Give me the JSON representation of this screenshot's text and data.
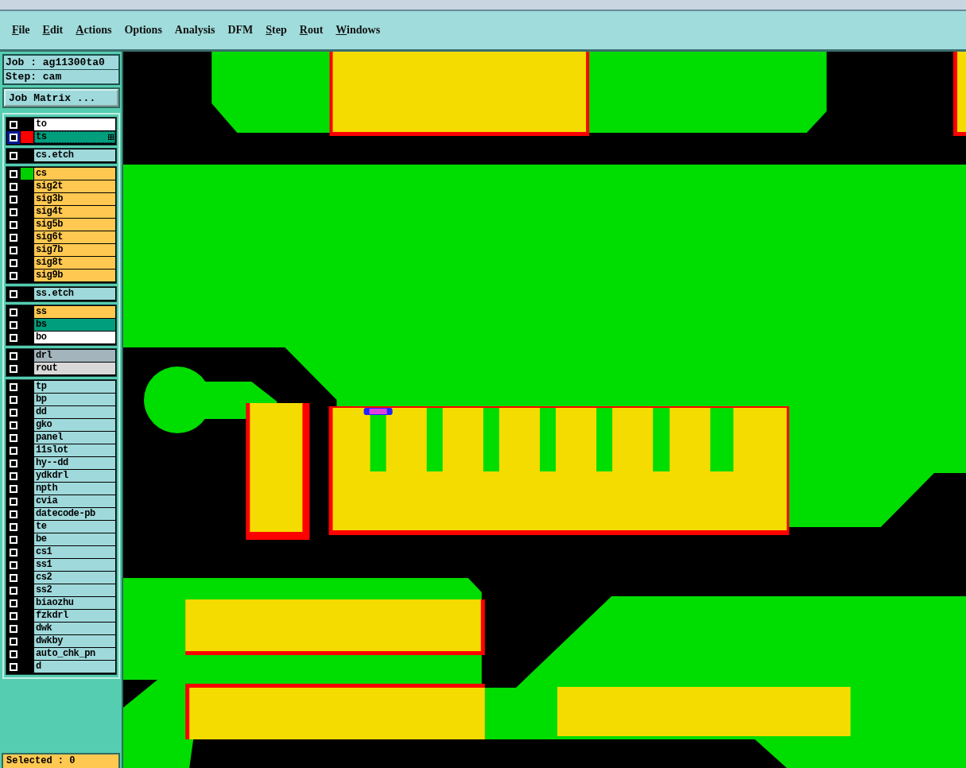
{
  "menu": [
    {
      "label": "File",
      "underlined": true
    },
    {
      "label": "Edit",
      "underlined": true
    },
    {
      "label": "Actions",
      "underlined": true
    },
    {
      "label": "Options",
      "underlined": false
    },
    {
      "label": "Analysis",
      "underlined": false
    },
    {
      "label": "DFM",
      "underlined": false
    },
    {
      "label": "Step",
      "underlined": true
    },
    {
      "label": "Rout",
      "underlined": true
    },
    {
      "label": "Windows",
      "underlined": true
    }
  ],
  "job": {
    "job_label": "Job : ag11300ta0",
    "step_label": "Step: cam",
    "matrix_button": "Job Matrix ..."
  },
  "layer_groups": [
    [
      {
        "name": "to",
        "kind": "silk",
        "checked": true,
        "selected": false
      },
      {
        "name": "ts",
        "kind": "mask",
        "checked": true,
        "selected": true,
        "color": "#ff0000"
      }
    ],
    [
      {
        "name": "cs.etch",
        "kind": "misc",
        "checked": true,
        "selected": false
      }
    ],
    [
      {
        "name": "cs",
        "kind": "signal",
        "checked": true,
        "selected": false,
        "color": "#00d000"
      },
      {
        "name": "sig2t",
        "kind": "signal",
        "checked": true,
        "selected": false
      },
      {
        "name": "sig3b",
        "kind": "signal",
        "checked": true,
        "selected": false
      },
      {
        "name": "sig4t",
        "kind": "signal",
        "checked": true,
        "selected": false
      },
      {
        "name": "sig5b",
        "kind": "signal",
        "checked": true,
        "selected": false
      },
      {
        "name": "sig6t",
        "kind": "signal",
        "checked": true,
        "selected": false
      },
      {
        "name": "sig7b",
        "kind": "signal",
        "checked": true,
        "selected": false
      },
      {
        "name": "sig8t",
        "kind": "signal",
        "checked": true,
        "selected": false
      },
      {
        "name": "sig9b",
        "kind": "signal",
        "checked": true,
        "selected": false
      }
    ],
    [
      {
        "name": "ss.etch",
        "kind": "misc",
        "checked": true,
        "selected": false
      }
    ],
    [
      {
        "name": "ss",
        "kind": "signal",
        "checked": true,
        "selected": false
      },
      {
        "name": "bs",
        "kind": "mask",
        "checked": true,
        "selected": false
      },
      {
        "name": "bo",
        "kind": "silk",
        "checked": true,
        "selected": false
      }
    ],
    [
      {
        "name": "drl",
        "kind": "drill",
        "checked": true,
        "selected": false
      },
      {
        "name": "rout",
        "kind": "rout",
        "checked": true,
        "selected": false
      }
    ],
    [
      {
        "name": "tp",
        "kind": "misc",
        "checked": true,
        "selected": false
      },
      {
        "name": "bp",
        "kind": "misc",
        "checked": true,
        "selected": false
      },
      {
        "name": "dd",
        "kind": "misc",
        "checked": true,
        "selected": false
      },
      {
        "name": "gko",
        "kind": "misc",
        "checked": true,
        "selected": false
      },
      {
        "name": "panel",
        "kind": "misc",
        "checked": true,
        "selected": false
      },
      {
        "name": "11slot",
        "kind": "misc",
        "checked": true,
        "selected": false
      },
      {
        "name": "hy--dd",
        "kind": "misc",
        "checked": true,
        "selected": false
      },
      {
        "name": "ydkdrl",
        "kind": "misc",
        "checked": true,
        "selected": false
      },
      {
        "name": "npth",
        "kind": "misc",
        "checked": true,
        "selected": false
      },
      {
        "name": "cvia",
        "kind": "misc",
        "checked": true,
        "selected": false
      },
      {
        "name": "datecode-pb",
        "kind": "misc",
        "checked": true,
        "selected": false
      },
      {
        "name": "te",
        "kind": "misc",
        "checked": true,
        "selected": false
      },
      {
        "name": "be",
        "kind": "misc",
        "checked": true,
        "selected": false
      },
      {
        "name": "cs1",
        "kind": "misc",
        "checked": true,
        "selected": false
      },
      {
        "name": "ss1",
        "kind": "misc",
        "checked": true,
        "selected": false
      },
      {
        "name": "cs2",
        "kind": "misc",
        "checked": true,
        "selected": false
      },
      {
        "name": "ss2",
        "kind": "misc",
        "checked": true,
        "selected": false
      },
      {
        "name": "biaozhu",
        "kind": "misc",
        "checked": true,
        "selected": false
      },
      {
        "name": "fzkdrl",
        "kind": "misc",
        "checked": true,
        "selected": false
      },
      {
        "name": "dwk",
        "kind": "misc",
        "checked": true,
        "selected": false
      },
      {
        "name": "dwkby",
        "kind": "misc",
        "checked": true,
        "selected": false
      },
      {
        "name": "auto_chk_pn",
        "kind": "misc",
        "checked": true,
        "selected": false
      },
      {
        "name": "d",
        "kind": "misc",
        "checked": true,
        "selected": false
      }
    ]
  ],
  "status": "Selected : 0"
}
